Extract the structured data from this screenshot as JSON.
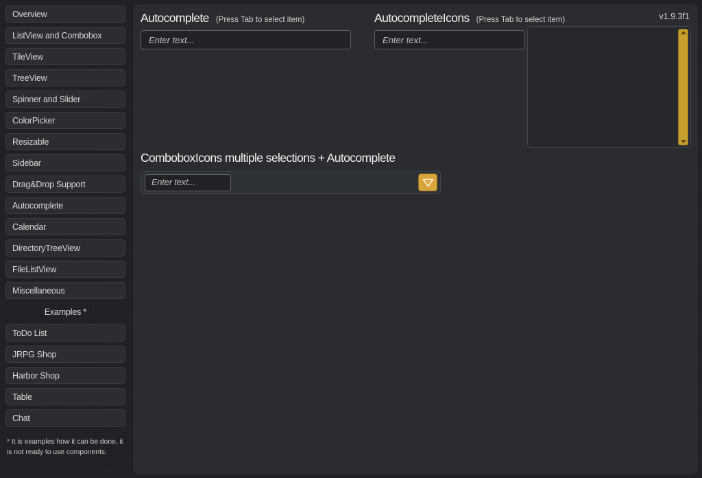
{
  "version": "v1.9.3f1",
  "sidebar": {
    "items": [
      {
        "label": "Overview"
      },
      {
        "label": "ListView and Combobox"
      },
      {
        "label": "TileView"
      },
      {
        "label": "TreeView"
      },
      {
        "label": "Spinner and Slider"
      },
      {
        "label": "ColorPicker"
      },
      {
        "label": "Resizable"
      },
      {
        "label": "Sidebar"
      },
      {
        "label": "Drag&Drop Support"
      },
      {
        "label": "Autocomplete"
      },
      {
        "label": "Calendar"
      },
      {
        "label": "DirectoryTreeView"
      },
      {
        "label": "FileListView"
      },
      {
        "label": "Miscellaneous"
      }
    ],
    "section_label": "Examples *",
    "example_items": [
      {
        "label": "ToDo List"
      },
      {
        "label": "JRPG Shop"
      },
      {
        "label": "Harbor Shop"
      },
      {
        "label": "Table"
      },
      {
        "label": "Chat"
      }
    ],
    "note": "* It is examples how it can be done, it is not ready to use components."
  },
  "main": {
    "autocomplete": {
      "title": "Autocomplete",
      "hint": "(Press Tab to select item)",
      "input_placeholder": "Enter text...",
      "input_value": ""
    },
    "autocomplete_icons": {
      "title": "AutocompleteIcons",
      "hint": "(Press Tab to select item)",
      "input_placeholder": "Enter text...",
      "input_value": ""
    },
    "combobox_icons": {
      "title": "ComboboxIcons multiple selections + Autocomplete",
      "input_placeholder": "Enter text...",
      "input_value": ""
    }
  },
  "colors": {
    "accent": "#d9a43a",
    "scrollbar": "#c8a02e",
    "panel_bg": "#2a2c2f",
    "app_bg": "#1f2124",
    "input_bg": "#202225"
  }
}
